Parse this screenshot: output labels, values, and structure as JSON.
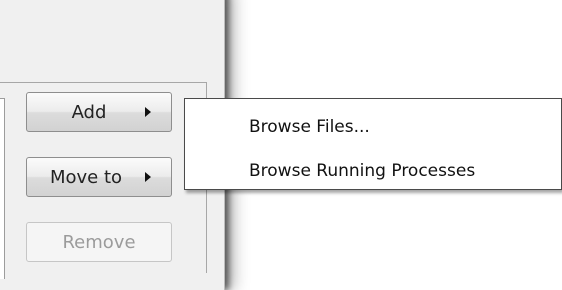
{
  "buttons": {
    "add_label": "Add",
    "move_to_label": "Move to",
    "remove_label": "Remove"
  },
  "add_submenu": {
    "items": [
      {
        "label": "Browse Files..."
      },
      {
        "label": "Browse Running Processes"
      }
    ]
  },
  "icons": {
    "submenu_arrow": "submenu-arrow-icon"
  }
}
